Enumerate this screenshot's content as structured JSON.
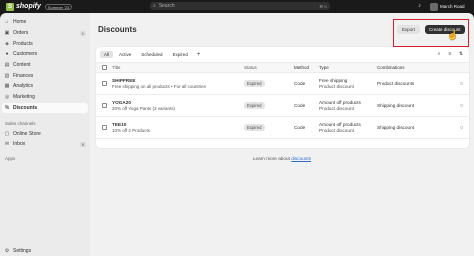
{
  "topbar": {
    "brand_letter": "S",
    "brand_name": "shopify",
    "edition_badge": "Summer '23",
    "search_placeholder": "Search",
    "search_shortcut": "⌘ K",
    "store_name": "March Road"
  },
  "sidebar": {
    "items": [
      {
        "label": "Home",
        "icon": "home-icon",
        "glyph": "⌂",
        "count": ""
      },
      {
        "label": "Orders",
        "icon": "orders-icon",
        "glyph": "▣",
        "count": "1"
      },
      {
        "label": "Products",
        "icon": "tag-icon",
        "glyph": "◈",
        "count": ""
      },
      {
        "label": "Customers",
        "icon": "person-icon",
        "glyph": "●",
        "count": ""
      },
      {
        "label": "Content",
        "icon": "content-icon",
        "glyph": "▤",
        "count": ""
      },
      {
        "label": "Finances",
        "icon": "bank-icon",
        "glyph": "▥",
        "count": ""
      },
      {
        "label": "Analytics",
        "icon": "chart-icon",
        "glyph": "▦",
        "count": ""
      },
      {
        "label": "Marketing",
        "icon": "target-icon",
        "glyph": "◎",
        "count": ""
      },
      {
        "label": "Discounts",
        "icon": "discount-icon",
        "glyph": "%",
        "count": ""
      }
    ],
    "sales_channels_label": "Sales channels",
    "channels": [
      {
        "label": "Online Store",
        "icon": "store-icon",
        "glyph": "▢",
        "count": ""
      },
      {
        "label": "Inbox",
        "icon": "inbox-icon",
        "glyph": "✉",
        "count": "5"
      }
    ],
    "apps_label": "Apps",
    "settings_label": "Settings"
  },
  "main": {
    "title": "Discounts",
    "export_label": "Export",
    "create_label": "Create discount",
    "tabs": [
      "All",
      "Active",
      "Scheduled",
      "Expired"
    ],
    "add_tab": "+",
    "columns": {
      "title": "Title",
      "status": "Status",
      "method": "Method",
      "type": "Type",
      "combinations": "Combinations"
    },
    "rows": [
      {
        "code": "SHIPFREE",
        "summary": "Free shipping on all products • For all countries",
        "status": "Expired",
        "method": "Code",
        "type": "Free shipping",
        "type_sub": "Product discount",
        "combinations": "Product discounts",
        "uses": "0"
      },
      {
        "code": "YOGA20",
        "summary": "20% off Yoga Pants (3 variants)",
        "status": "Expired",
        "method": "Code",
        "type": "Amount off products",
        "type_sub": "Product discount",
        "combinations": "Shipping discount",
        "uses": "0"
      },
      {
        "code": "TEE10",
        "summary": "10% off 2 Products",
        "status": "Expired",
        "method": "Code",
        "type": "Amount off products",
        "type_sub": "Product discount",
        "combinations": "Shipping discount",
        "uses": "0"
      }
    ],
    "learn_prefix": "Learn more about",
    "learn_link": "discounts"
  },
  "colors": {
    "accent_dark": "#303030",
    "highlight": "#d61f2c",
    "shopify_green": "#95bf47",
    "link": "#2c6ecb"
  }
}
